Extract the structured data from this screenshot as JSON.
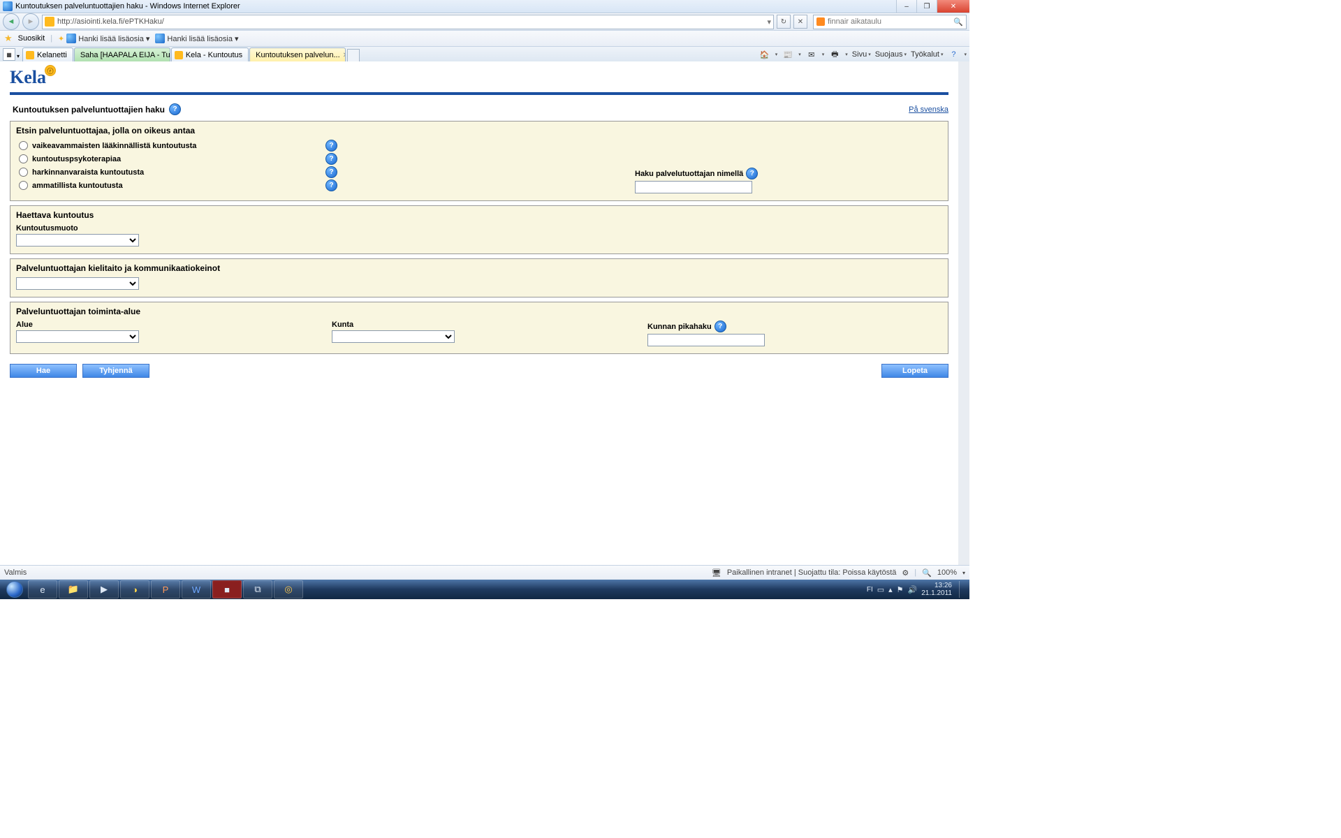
{
  "window": {
    "title": "Kuntoutuksen palveluntuottajien haku - Windows Internet Explorer",
    "min_tip": "–",
    "max_tip": "❐",
    "close_tip": "✕"
  },
  "nav": {
    "url": "http://asiointi.kela.fi/ePTKHaku/",
    "refresh": "↻",
    "stop": "✕",
    "search_placeholder": "finnair aikataulu"
  },
  "favbar": {
    "favorites": "Suosikit",
    "items": [
      "Hanki lisää lisäosia ▾",
      "Hanki lisää lisäosia ▾"
    ]
  },
  "tabs": [
    {
      "label": "Kelanetti",
      "icon": "k"
    },
    {
      "label": "Saha [HAAPALA EIJA - Tu...",
      "icon": "e"
    },
    {
      "label": "Kela - Kuntoutus",
      "icon": "k"
    },
    {
      "label": "Kuntoutuksen palvelun...",
      "icon": "k",
      "active": true
    }
  ],
  "cmdbar": {
    "sivu": "Sivu",
    "suojaus": "Suojaus",
    "tyokalut": "Työkalut"
  },
  "page": {
    "logo": "Kela",
    "title": "Kuntoutuksen palveluntuottajien haku",
    "swedish_link": "På svenska",
    "section1": {
      "heading": "Etsin palveluntuottajaa, jolla on oikeus antaa",
      "options": [
        "vaikeavammaisten lääkinnällistä kuntoutusta",
        "kuntoutuspsykoterapiaa",
        "harkinnanvaraista kuntoutusta",
        "ammatillista kuntoutusta"
      ],
      "name_label": "Haku palvelutuottajan nimellä"
    },
    "section2": {
      "heading": "Haettava kuntoutus",
      "sub": "Kuntoutusmuoto"
    },
    "section3": {
      "heading": "Palveluntuottajan kielitaito ja kommunikaatiokeinot"
    },
    "section4": {
      "heading": "Palveluntuottajan toiminta-alue",
      "alue": "Alue",
      "kunta": "Kunta",
      "pikahaku": "Kunnan pikahaku"
    },
    "buttons": {
      "hae": "Hae",
      "tyhjenna": "Tyhjennä",
      "lopeta": "Lopeta"
    }
  },
  "status": {
    "left": "Valmis",
    "right": "Paikallinen intranet | Suojattu tila: Poissa käytöstä",
    "zoom": "100%"
  },
  "tray": {
    "lang": "FI",
    "time": "13:26",
    "date": "21.1.2011"
  }
}
